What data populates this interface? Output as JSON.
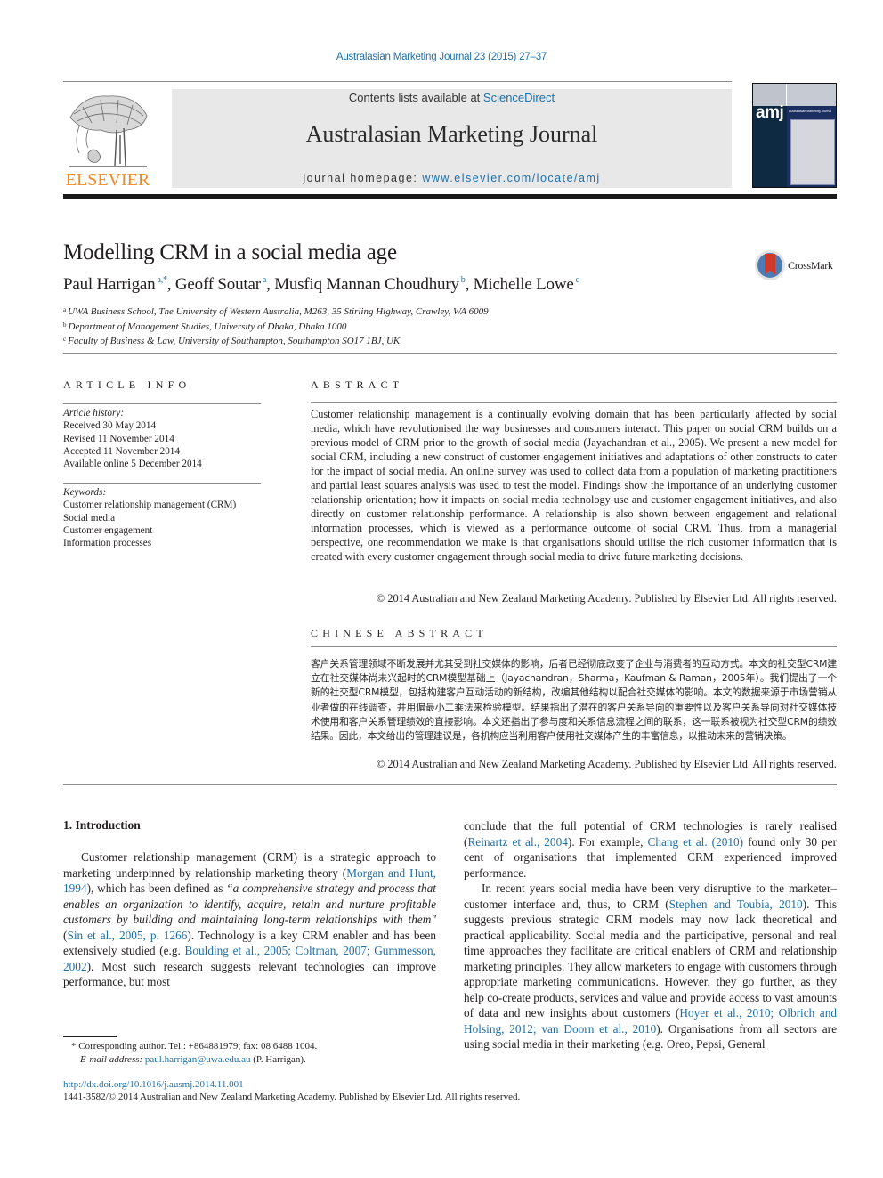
{
  "running_header": {
    "citation": "Australasian Marketing Journal 23 (2015) 27–37"
  },
  "masthead": {
    "publisher_logo_text": "ELSEVIER",
    "contents_prefix": "Contents lists available at ",
    "contents_link": "ScienceDirect",
    "journal_name": "Australasian Marketing Journal",
    "homepage_prefix": "journal homepage: ",
    "homepage_link": "www.elsevier.com/locate/amj",
    "cover": {
      "abbrev": "amj",
      "subtitle": "Australasian Marketing Journal"
    }
  },
  "article": {
    "title": "Modelling CRM in a social media age",
    "crossmark_label": "CrossMark",
    "authors": [
      {
        "name": "Paul Harrigan",
        "marks": "a,*",
        "sep": ", "
      },
      {
        "name": "Geoff Soutar",
        "marks": "a",
        "sep": ", "
      },
      {
        "name": "Musfiq Mannan Choudhury",
        "marks": "b",
        "sep": ", "
      },
      {
        "name": "Michelle Lowe",
        "marks": "c",
        "sep": ""
      }
    ],
    "affiliations": [
      {
        "mark": "a",
        "text": "UWA Business School, The University of Western Australia, M263, 35 Stirling Highway, Crawley, WA 6009"
      },
      {
        "mark": "b",
        "text": "Department of Management Studies, University of Dhaka, Dhaka 1000"
      },
      {
        "mark": "c",
        "text": "Faculty of Business & Law, University of Southampton, Southampton SO17 1BJ, UK"
      }
    ]
  },
  "article_info": {
    "heading": "ARTICLE INFO",
    "history_label": "Article history:",
    "history": [
      "Received 30 May 2014",
      "Revised 11 November 2014",
      "Accepted 11 November 2014",
      "Available online 5 December 2014"
    ],
    "keywords_label": "Keywords:",
    "keywords": [
      "Customer relationship management (CRM)",
      "Social media",
      "Customer engagement",
      "Information processes"
    ]
  },
  "abstract": {
    "heading": "ABSTRACT",
    "text": "Customer relationship management is a continually evolving domain that has been particularly affected by social media, which have revolutionised the way businesses and consumers interact. This paper on social CRM builds on a previous model of CRM prior to the growth of social media (Jayachandran et al., 2005). We present a new model for social CRM, including a new construct of customer engagement initiatives and adaptations of other constructs to cater for the impact of social media. An online survey was used to collect data from a population of marketing practitioners and partial least squares analysis was used to test the model. Findings show the importance of an underlying customer relationship orientation; how it impacts on social media technology use and customer engagement initiatives, and also directly on customer relationship performance. A relationship is also shown between engagement and relational information processes, which is viewed as a performance outcome of social CRM. Thus, from a managerial perspective, one recommendation we make is that organisations should utilise the rich customer information that is created with every customer engagement through social media to drive future marketing decisions.",
    "copyright": "© 2014 Australian and New Zealand Marketing Academy. Published by Elsevier Ltd. All rights reserved."
  },
  "chinese_abstract": {
    "heading": "CHINESE ABSTRACT",
    "text": "客户关系管理领域不断发展并尤其受到社交媒体的影响，后者已经彻底改变了企业与消费者的互动方式。本文的社交型CRM建立在社交媒体尚未兴起时的CRM模型基础上（Jayachandran，Sharma，Kaufman & Raman，2005年）。我们提出了一个新的社交型CRM模型，包括构建客户互动活动的新结构，改编其他结构以配合社交媒体的影响。本文的数据来源于市场营销从业者做的在线调查，并用偏最小二乘法来检验模型。结果指出了潜在的客户关系导向的重要性以及客户关系导向对社交媒体技术使用和客户关系管理绩效的直接影响。本文还指出了参与度和关系信息流程之间的联系，这一联系被视为社交型CRM的绩效结果。因此，本文给出的管理建议是，各机构应当利用客户使用社交媒体产生的丰富信息，以推动未来的营销决策。",
    "copyright": "© 2014 Australian and New Zealand Marketing Academy. Published by Elsevier Ltd. All rights reserved."
  },
  "introduction": {
    "heading": "1.  Introduction",
    "left_column": {
      "p1_a": "Customer relationship management (CRM) is a strategic approach to marketing underpinned by relationship marketing theory (",
      "p1_ref1": "Morgan and Hunt, 1994",
      "p1_b": "), which has been defined as ",
      "p1_quote": "“a comprehensive strategy and process that enables an organization to identify, acquire, retain and nurture profitable customers by building and maintaining long-term relationships with them\"",
      "p1_c": " (",
      "p1_ref2": "Sin et al., 2005, p. 1266",
      "p1_d": "). Technology is a key CRM enabler and has been extensively studied (e.g. ",
      "p1_ref3": "Boulding et al., 2005; Coltman, 2007; Gummesson, 2002",
      "p1_e": "). Most such research suggests relevant technologies can improve performance, but most"
    },
    "right_column": {
      "p1_a": "conclude that the full potential of CRM technologies is rarely realised (",
      "p1_ref1": "Reinartz et al., 2004",
      "p1_b": "). For example, ",
      "p1_ref2": "Chang et al. (2010)",
      "p1_c": " found only 30 per cent of organisations that implemented CRM experienced improved performance.",
      "p2_a": "In recent years social media have been very disruptive to the marketer–customer interface and, thus, to CRM (",
      "p2_ref1": "Stephen and Toubia, 2010",
      "p2_b": "). This suggests previous strategic CRM models may now lack theoretical and practical applicability. Social media and the participative, personal and real time approaches they facilitate are critical enablers of CRM and relationship marketing principles. They allow marketers to engage with customers through appropriate marketing communications. However, they go further, as they help co-create products, services and value and provide access to vast amounts of data and new insights about customers (",
      "p2_ref2": "Hoyer et al., 2010; Olbrich and Holsing, 2012; van Doorn et al., 2010",
      "p2_c": "). Organisations from all sectors are using social media in their marketing (e.g. Oreo, Pepsi, General"
    }
  },
  "footnotes": {
    "corresponding": "* Corresponding author. Tel.: +864881979; fax: 08 6488 1004.",
    "email_label": "E-mail address: ",
    "email": "paul.harrigan@uwa.edu.au",
    "email_suffix": " (P. Harrigan).",
    "doi": "http://dx.doi.org/10.1016/j.ausmj.2014.11.001",
    "issn_line": "1441-3582/© 2014 Australian and New Zealand Marketing Academy. Published by Elsevier Ltd. All rights reserved."
  },
  "colors": {
    "link": "#1f6fa7",
    "elsevier_orange": "#f08a24",
    "masthead_bg": "#e8e8e9",
    "text": "#231f20"
  }
}
